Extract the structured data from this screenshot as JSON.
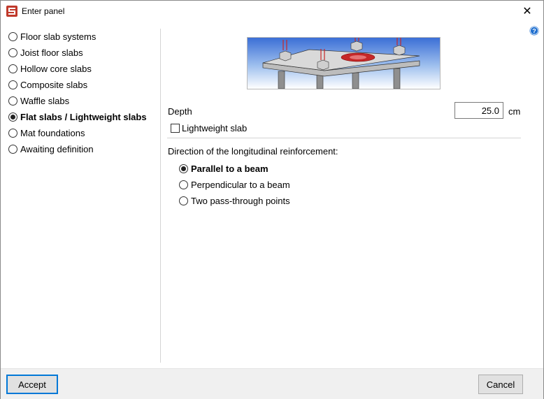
{
  "window": {
    "title": "Enter panel"
  },
  "panel_types": [
    {
      "label": "Floor slab systems",
      "selected": false
    },
    {
      "label": "Joist floor slabs",
      "selected": false
    },
    {
      "label": "Hollow core slabs",
      "selected": false
    },
    {
      "label": "Composite slabs",
      "selected": false
    },
    {
      "label": "Waffle slabs",
      "selected": false
    },
    {
      "label": "Flat slabs / Lightweight slabs",
      "selected": true
    },
    {
      "label": "Mat foundations",
      "selected": false
    },
    {
      "label": "Awaiting definition",
      "selected": false
    }
  ],
  "settings": {
    "depth_label": "Depth",
    "depth_value": "25.0",
    "depth_unit": "cm",
    "lightweight_label": "Lightweight slab",
    "lightweight_checked": false,
    "direction_label": "Direction of the longitudinal reinforcement:",
    "direction_options": [
      {
        "label": "Parallel to a beam",
        "selected": true
      },
      {
        "label": "Perpendicular to a beam",
        "selected": false
      },
      {
        "label": "Two pass-through points",
        "selected": false
      }
    ]
  },
  "footer": {
    "accept_label": "Accept",
    "cancel_label": "Cancel"
  },
  "colors": {
    "accent": "#0078d7",
    "app_icon": "#c0392b",
    "help_icon": "#1f6fcf"
  },
  "icons": {
    "app": "app-logo-icon",
    "close": "close-icon",
    "help": "help-icon"
  }
}
